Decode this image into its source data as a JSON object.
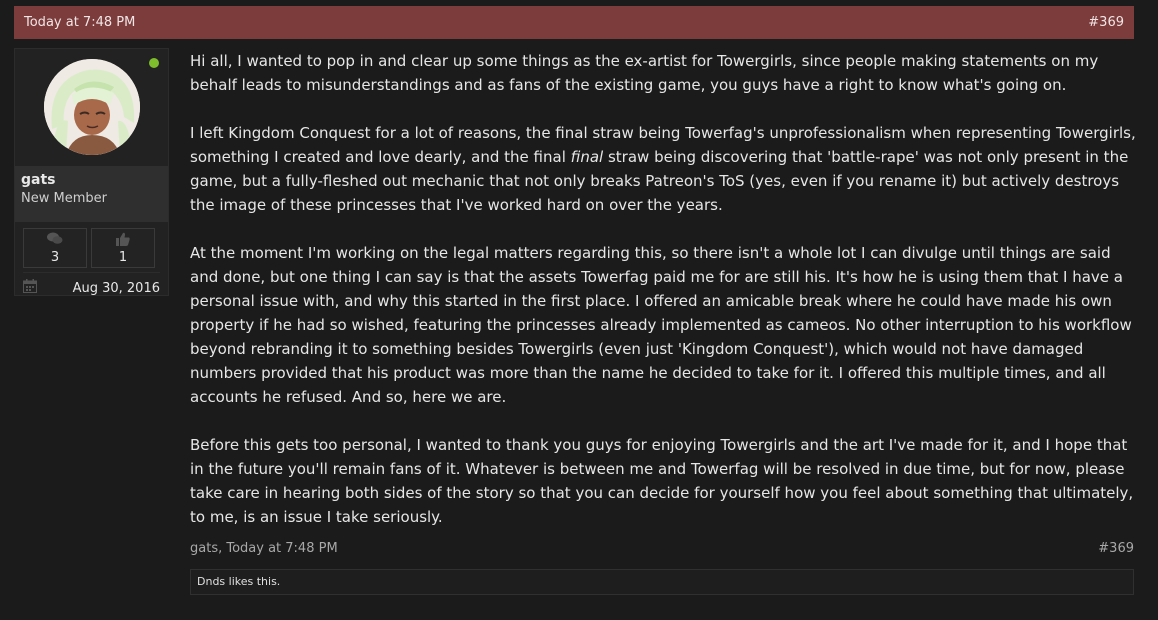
{
  "post": {
    "timestamp": "Today at 7:48 PM",
    "number": "#369"
  },
  "user": {
    "name": "gats",
    "title": "New Member",
    "messages": "3",
    "likes": "1",
    "joined": "Aug 30, 2016",
    "online_color": "#7ebd2c"
  },
  "message": {
    "p1": "Hi all, I wanted to pop in and clear up some things as the ex-artist for Towergirls, since people making statements on my behalf leads to misunderstandings and as fans of the existing game, you guys have a right to know what's going on.",
    "p2_before": "I left Kingdom Conquest for a lot of reasons, the final straw being Towerfag's unprofessionalism when representing Towergirls, something I created and love dearly, and the final ",
    "p2_em": "final",
    "p2_after": " straw being discovering that 'battle-rape' was not only present in the game, but a fully-fleshed out mechanic that not only breaks Patreon's ToS (yes, even if you rename it) but actively destroys the image of these princesses that I've worked hard on over the years.",
    "p3": "At the moment I'm working on the legal matters regarding this, so there isn't a whole lot I can divulge until things are said and done, but one thing I can say is that the assets Towerfag paid me for are still his. It's how he is using them that I have a personal issue with, and why this started in the first place. I offered an amicable break where he could have made his own property if he had so wished, featuring the princesses already implemented as cameos. No other interruption to his workflow beyond rebranding it to something besides Towergirls (even just 'Kingdom Conquest'), which would not have damaged numbers provided that his product was more than the name he decided to take for it. I offered this multiple times, and all accounts he refused. And so, here we are.",
    "p4": "Before this gets too personal, I wanted to thank you guys for enjoying Towergirls and the art I've made for it, and I hope that in the future you'll remain fans of it. Whatever is between me and Towerfag will be resolved in due time, but for now, please take care in hearing both sides of the story so that you can decide for yourself how you feel about something that ultimately, to me, is an issue I take seriously."
  },
  "footer": {
    "author_time": "gats, Today at 7:48 PM",
    "number": "#369"
  },
  "likes_bar": {
    "liker": "Dnds",
    "suffix": " likes this."
  },
  "icons": {
    "messages": "speech-bubbles-icon",
    "likes": "thumbs-up-icon",
    "joined": "calendar-icon"
  },
  "colors": {
    "header_bg": "#7c3c3c",
    "page_bg": "#1b1b1b"
  }
}
